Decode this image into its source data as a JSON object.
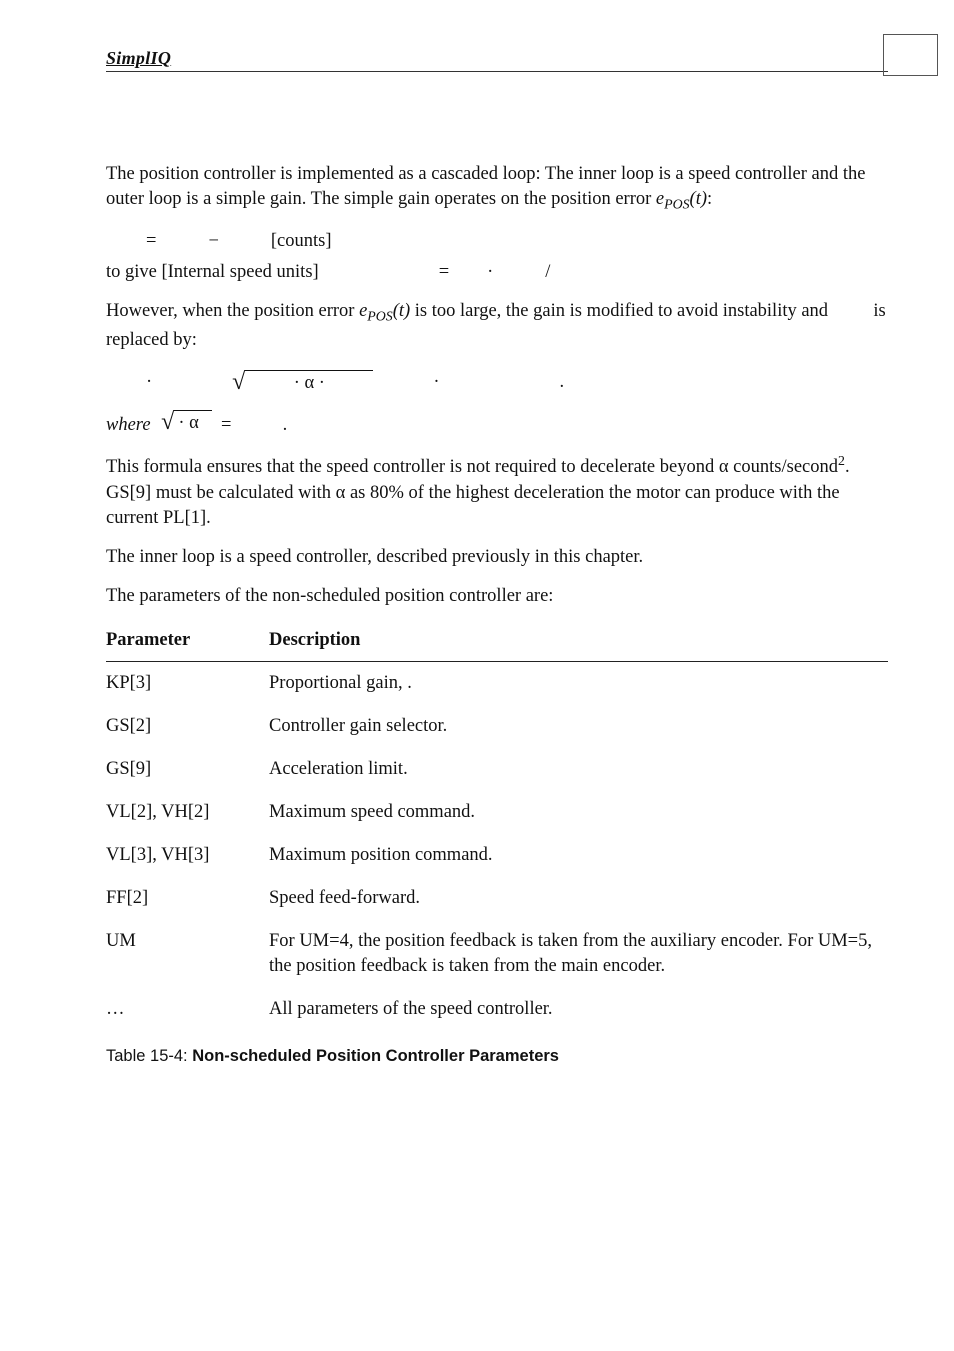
{
  "header": {
    "brand": "SimplIQ"
  },
  "body": {
    "p1": "The position controller is implemented as a cascaded loop: The inner loop is a speed controller and the outer loop is a simple gain. The simple gain operates on the position error ",
    "p1_ital": "e",
    "p1_sub": "POS",
    "p1_arg": "(t)",
    "p1_tail": ":",
    "eq1": {
      "eq": "=",
      "minus": "−",
      "units": "[counts]"
    },
    "eq2_pre": "to give [Internal speed units]",
    "eq2": {
      "eq": "=",
      "dot": "·",
      "slash": "/"
    },
    "p2a": "However, when the position error ",
    "p2_ital": "e",
    "p2_sub": "POS",
    "p2_arg": "(t)",
    "p2b": " is too large, the gain is modified to avoid instability and ",
    "p2c": " is replaced by:",
    "eq3": {
      "dot1": "·",
      "alpha": "· α ·",
      "dot2": "·",
      "dot3": "."
    },
    "eq4_pre": "where",
    "eq4_alpha": "· α",
    "eq4_eq": "=",
    "eq4_tail": ".",
    "p3a": "This formula ensures that the speed controller is not required to decelerate beyond α counts/second",
    "p3_sup": "2",
    "p3b": ". GS[9] must be calculated with α as 80% of the highest deceleration the motor can produce with the current PL[1].",
    "p4": "The inner loop is a speed controller, described previously in this chapter.",
    "p5": "The parameters of the non-scheduled position controller are:"
  },
  "table": {
    "head_param": "Parameter",
    "head_desc": "Description",
    "rows": [
      {
        "param": "KP[3]",
        "desc": "Proportional gain,      ."
      },
      {
        "param": "GS[2]",
        "desc": "Controller gain selector."
      },
      {
        "param": "GS[9]",
        "desc": "Acceleration limit."
      },
      {
        "param": "VL[2], VH[2]",
        "desc": "Maximum speed command."
      },
      {
        "param": "VL[3], VH[3]",
        "desc": "Maximum position command."
      },
      {
        "param": "FF[2]",
        "desc": "Speed feed-forward."
      },
      {
        "param": "UM",
        "desc": "For UM=4, the position feedback is taken from the auxiliary encoder. For UM=5, the position feedback is taken from the main encoder."
      },
      {
        "param": "…",
        "desc": "All parameters of the speed controller."
      }
    ]
  },
  "caption": {
    "pre": "Table 15-4: ",
    "bold": "Non-scheduled Position Controller Parameters"
  }
}
